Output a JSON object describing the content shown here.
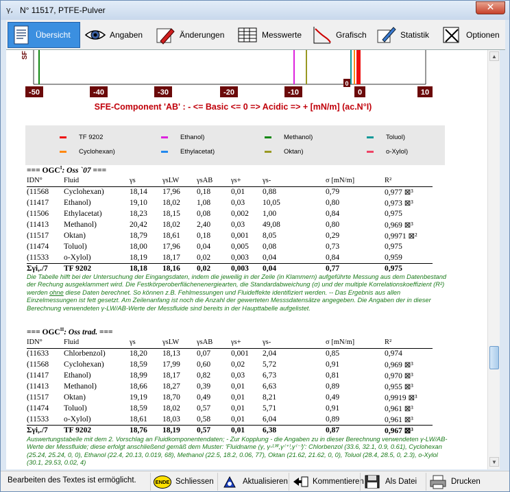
{
  "window": {
    "title": "N° 11517,  PTFE-Pulver",
    "close_glyph": "✕"
  },
  "tabs": [
    {
      "label": "Übersicht",
      "icon": "document-icon",
      "active": true
    },
    {
      "label": "Angaben",
      "icon": "eye-icon",
      "active": false
    },
    {
      "label": "Änderungen",
      "icon": "edit-pencil-icon",
      "active": false
    },
    {
      "label": "Messwerte",
      "icon": "table-icon",
      "active": false
    },
    {
      "label": "Grafisch",
      "icon": "graph-icon",
      "active": false
    },
    {
      "label": "Statistik",
      "icon": "statistics-pen-icon",
      "active": false
    },
    {
      "label": "Optionen",
      "icon": "options-icon",
      "active": false
    }
  ],
  "chart": {
    "title": "SFE-Component 'AB' : - <= Basic <= 0 => Acidic => + [mN/m] (ac.N°I)",
    "ticks": [
      "-50",
      "-40",
      "-30",
      "-20",
      "-10",
      "0",
      "0",
      "10"
    ],
    "side_label": "SF",
    "colors": {
      "tick_bg": "#6b0a0a",
      "title": "#c0000a"
    },
    "legend": [
      {
        "name": "TF 9202",
        "color": "#ee1111"
      },
      {
        "name": "Ethanol)",
        "color": "#dd22dd"
      },
      {
        "name": "Methanol)",
        "color": "#118811"
      },
      {
        "name": "Toluol)",
        "color": "#119999"
      },
      {
        "name": "Cyclohexan)",
        "color": "#ff8811"
      },
      {
        "name": "Ethylacetat)",
        "color": "#2288ee"
      },
      {
        "name": "Oktan)",
        "color": "#999922"
      },
      {
        "name": "o-Xylol)",
        "color": "#ee4466"
      }
    ]
  },
  "section1": {
    "heading_prefix": "=== OGC",
    "heading_sup": "I",
    "heading_italic": ": Oss `07",
    "heading_suffix": " ===",
    "headers": [
      "IDN°",
      "Fluid",
      "γs",
      "γsLW",
      "γsAB",
      "γs+",
      "γs-",
      "σ [mN/m]",
      "R²"
    ],
    "rows": [
      [
        "(11568",
        "Cyclohexan)",
        "18,14",
        "17,96",
        "0,18",
        "0,01",
        "0,88",
        "0,79",
        "0,977 ⊠³"
      ],
      [
        "(11417",
        "Ethanol)",
        "19,10",
        "18,02",
        "1,08",
        "0,03",
        "10,05",
        "0,80",
        "0,973 ⊠³"
      ],
      [
        "(11506",
        "Ethylacetat)",
        "18,23",
        "18,15",
        "0,08",
        "0,002",
        "1,00",
        "0,84",
        "0,975"
      ],
      [
        "(11413",
        "Methanol)",
        "20,42",
        "18,02",
        "2,40",
        "0,03",
        "49,08",
        "0,80",
        "0,969 ⊠³"
      ],
      [
        "(11517",
        "Oktan)",
        "18,79",
        "18,61",
        "0,18",
        "0,001",
        "8,05",
        "0,29",
        "0,9971 ⊠²"
      ],
      [
        "(11474",
        "Toluol)",
        "18,00",
        "17,96",
        "0,04",
        "0,005",
        "0,08",
        "0,73",
        "0,975"
      ],
      [
        "(11533",
        "o-Xylol)",
        "18,19",
        "18,17",
        "0,02",
        "0,003",
        "0,04",
        "0,84",
        "0,959"
      ]
    ],
    "summary": [
      "Σγi,./7",
      "TF 9202",
      "18,18",
      "18,16",
      "0,02",
      "0,003",
      "0,04",
      "0,77",
      "0,975"
    ],
    "note_before": "Die Tabelle hilft bei der Untersuchung der Eingangsdaten, indem die jeweilig in der Zeile (in Klammern) aufgeführte Messung aus dem Datenbestand der Rechung ausgeklammert wird. Die Festkörperoberflächenenergiearten, die Standardabweichung (σ) und der multiple Korrelationskoeffizient (R²) werden ",
    "note_underlined": "ohne",
    "note_after": " diese Daten berechnet. So können z.B. Fehlmessungen und Fluideffekte identifiziert werden. -- Das Ergebnis aus allen Einzelmessungen ist fett gesetzt. Am Zeilenanfang ist noch die Anzahl der gewerteten Messsdatensätze angegeben. Die Angaben der in dieser Berechnung verwendeten γ-LW/AB-Werte der Messfluide sind bereits in der Haupttabelle aufgelistet."
  },
  "section2": {
    "heading_prefix": "=== OGC",
    "heading_sup": "II",
    "heading_italic": ": Oss trad.",
    "heading_suffix": " ===",
    "headers": [
      "IDN°",
      "Fluid",
      "γs",
      "γsLW",
      "γsAB",
      "γs+",
      "γs-",
      "σ [mN/m]",
      "R²"
    ],
    "rows": [
      [
        "(11633",
        "Chlorbenzol)",
        "18,20",
        "18,13",
        "0,07",
        "0,001",
        "2,04",
        "0,85",
        "0,974"
      ],
      [
        "(11568",
        "Cyclohexan)",
        "18,59",
        "17,99",
        "0,60",
        "0,02",
        "5,72",
        "0,91",
        "0,969 ⊠³"
      ],
      [
        "(11417",
        "Ethanol)",
        "18,99",
        "18,17",
        "0,82",
        "0,03",
        "6,73",
        "0,81",
        "0,970 ⊠³"
      ],
      [
        "(11413",
        "Methanol)",
        "18,66",
        "18,27",
        "0,39",
        "0,01",
        "6,63",
        "0,89",
        "0,955 ⊠³"
      ],
      [
        "(11517",
        "Oktan)",
        "19,19",
        "18,70",
        "0,49",
        "0,01",
        "8,21",
        "0,49",
        "0,9919 ⊠³"
      ],
      [
        "(11474",
        "Toluol)",
        "18,59",
        "18,02",
        "0,57",
        "0,01",
        "5,71",
        "0,91",
        "0,961 ⊠³"
      ],
      [
        "(11533",
        "o-Xylol)",
        "18,61",
        "18,03",
        "0,58",
        "0,01",
        "6,04",
        "0,89",
        "0,961 ⊠³"
      ]
    ],
    "summary": [
      "Σγi,./7",
      "TF 9202",
      "18,76",
      "18,19",
      "0,57",
      "0,01",
      "6,38",
      "0,87",
      "0,967 ⊠³"
    ],
    "note": "Auswertungstabelle mit dem 2. Vorschlag an Fluidkomponentendaten; - Zur Kopplung - die Angaben zu in dieser Berechnung verwendeten γ-LW/AB-Werte der Messfluide; diese erfolgt anschließend gemäß dem Muster: 'Fluidname (γ, γ-ᴸᵂ,γ⁽⁺⁾,γ⁽⁻⁾)': Chlorbenzol (33.6, 32.1, 0.9, 0.61), Cyclohexan (25.24, 25.24, 0, 0), Ethanol (22.4, 20.13, 0.019, 68), Methanol (22.5, 18.2, 0.06, 77), Oktan (21.62, 21.62, 0, 0), Toluol (28.4, 28.5, 0, 2.3), o-Xylol (30.1, 29.53, 0.02, 4)"
  },
  "statusbar": {
    "text": "Bearbeiten des Textes ist ermöglicht.",
    "buttons": [
      {
        "label": "Schliessen",
        "icon": "ende-icon",
        "icon_text": "ENDE"
      },
      {
        "label": "Aktualisieren",
        "icon": "refresh-icon"
      },
      {
        "label": "Kommentieren",
        "icon": "comment-icon"
      },
      {
        "label": "Als Datei",
        "icon": "save-disk-icon"
      },
      {
        "label": "Drucken",
        "icon": "printer-icon"
      }
    ]
  }
}
